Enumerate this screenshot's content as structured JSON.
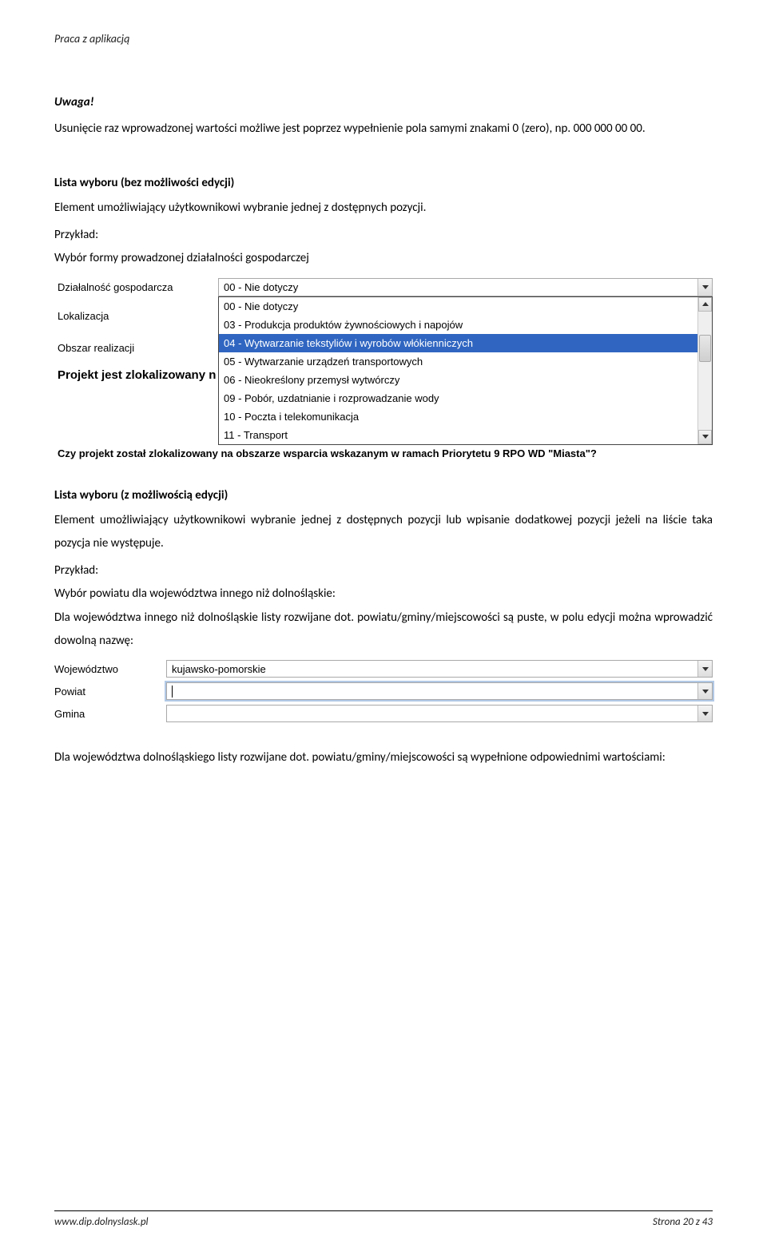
{
  "header": {
    "title": "Praca z aplikacją"
  },
  "intro": {
    "heading": "Uwaga!",
    "paragraph": "Usunięcie raz wprowadzonej wartości możliwe jest poprzez wypełnienie pola samymi znakami 0 (zero), np. 000 000 00 00."
  },
  "section1": {
    "title": "Lista wyboru (bez możliwości edycji)",
    "desc": "Element umożliwiający użytkownikowi wybranie jednej z dostępnych pozycji.",
    "example_label": "Przykład:",
    "example_text": "Wybór formy prowadzonej działalności gospodarczej"
  },
  "screenshot1": {
    "labels": {
      "dzialalnosc": "Działalność gospodarcza",
      "lokalizacja": "Lokalizacja",
      "obszar": "Obszar realizacji",
      "projekt_bold": "Projekt jest zlokalizowany n",
      "bottom_question": "Czy projekt został zlokalizowany na obszarze wsparcia wskazanym w ramach Priorytetu 9 RPO WD \"Miasta\"?"
    },
    "selected_value": "00 - Nie dotyczy",
    "options": [
      "00 - Nie dotyczy",
      "03 - Produkcja produktów żywnościowych i napojów",
      "04 - Wytwarzanie tekstyliów i wyrobów włókienniczych",
      "05 - Wytwarzanie urządzeń transportowych",
      "06 - Nieokreślony przemysł wytwórczy",
      "09 - Pobór, uzdatnianie i rozprowadzanie wody",
      "10 - Poczta i telekomunikacja",
      "11 - Transport"
    ],
    "selected_index": 2
  },
  "section2": {
    "title": "Lista wyboru (z możliwością edycji)",
    "desc": "Element umożliwiający użytkownikowi wybranie jednej z dostępnych pozycji lub wpisanie dodatkowej pozycji jeżeli na liście taka pozycja nie występuje.",
    "example_label": "Przykład:",
    "example_text": "Wybór powiatu dla województwa innego niż dolnośląskie:",
    "para2": "Dla województwa innego niż dolnośląskie listy rozwijane dot. powiatu/gminy/miejscowości są puste, w polu edycji można wprowadzić dowolną nazwę:"
  },
  "screenshot2": {
    "rows": [
      {
        "label": "Województwo",
        "value": "kujawsko-pomorskie",
        "kind": "select"
      },
      {
        "label": "Powiat",
        "value": "",
        "kind": "editable-active"
      },
      {
        "label": "Gmina",
        "value": "",
        "kind": "editable"
      }
    ]
  },
  "tail": {
    "para": "Dla województwa dolnośląskiego listy rozwijane dot. powiatu/gminy/miejscowości są wypełnione odpowiednimi wartościami:"
  },
  "footer": {
    "left": "www.dip.dolnyslask.pl",
    "right": "Strona 20 z 43"
  }
}
